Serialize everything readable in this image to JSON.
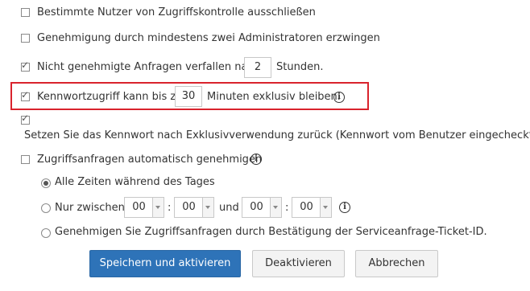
{
  "options": {
    "exclude_users": {
      "label": "Bestimmte Nutzer von Zugriffskontrolle ausschließen",
      "checked": false
    },
    "two_admins": {
      "label": "Genehmigung durch mindestens zwei Administratoren erzwingen",
      "checked": false
    },
    "expire_requests": {
      "label_before": "Nicht genehmigte Anfragen verfallen nach",
      "value": "2",
      "label_after": "Stunden.",
      "checked": true
    },
    "exclusive_access": {
      "label_before": "Kennwortzugriff kann bis zu",
      "value": "30",
      "label_after": "Minuten exklusiv bleiben.",
      "checked": true
    },
    "reset_password": {
      "label": "Setzen Sie das Kennwort nach Exklusivverwendung zurück (Kennwort vom Benutzer eingecheckt).",
      "checked": true
    },
    "auto_approve": {
      "label": "Zugriffsanfragen automatisch genehmigen",
      "checked": false
    }
  },
  "radios": {
    "all_day": {
      "label": "Alle Zeiten während des Tages",
      "selected": true
    },
    "between": {
      "label": "Nur zwischen",
      "from_hour": "00",
      "from_minute": "00",
      "and_label": "und",
      "to_hour": "00",
      "to_minute": "00",
      "colon": ":",
      "selected": false
    },
    "ticket": {
      "label": "Genehmigen Sie Zugriffsanfragen durch Bestätigung der Serviceanfrage-Ticket-ID.",
      "selected": false
    }
  },
  "buttons": {
    "save": "Speichern und aktivieren",
    "deactivate": "Deaktivieren",
    "cancel": "Abbrechen"
  },
  "icons": {
    "info": "info-icon",
    "tick": "✓",
    "info_glyph": "i"
  },
  "colors": {
    "primary": "#2e73b8",
    "highlight": "#d9232d"
  }
}
